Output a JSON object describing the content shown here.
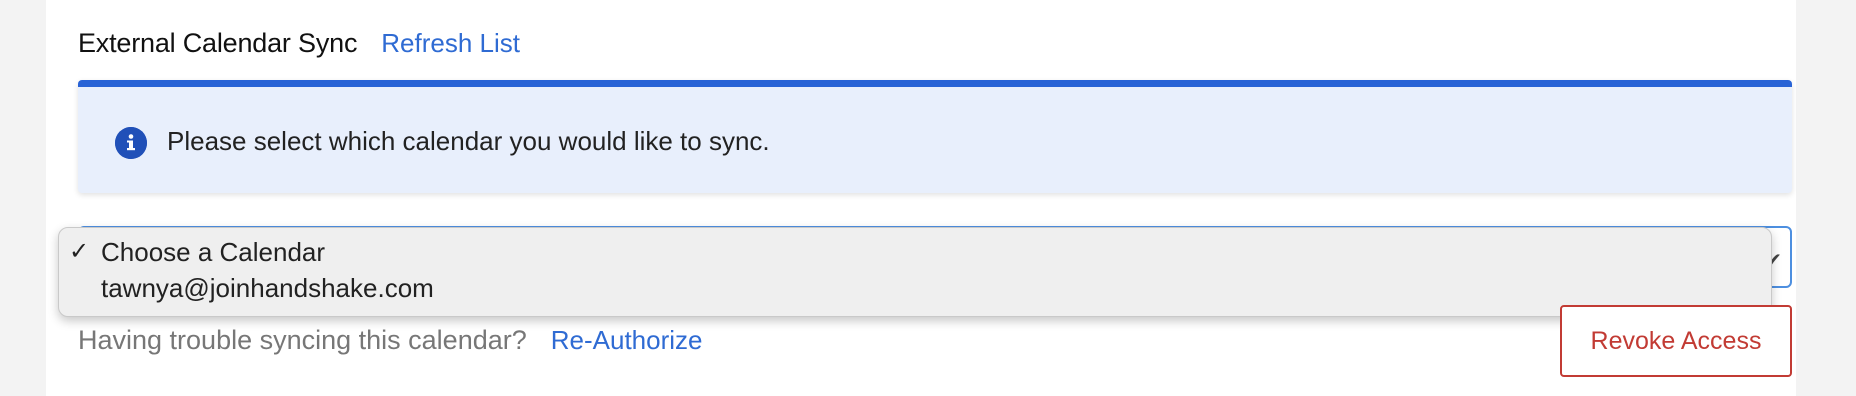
{
  "section": {
    "title": "External Calendar Sync",
    "refresh_label": "Refresh List"
  },
  "alert": {
    "icon": "info-icon",
    "message": "Please select which calendar you would like to sync."
  },
  "calendar_select": {
    "selected_value": "Choose a Calendar",
    "options": [
      {
        "label": "Choose a Calendar",
        "selected": true
      },
      {
        "label": "tawnya@joinhandshake.com",
        "selected": false
      }
    ],
    "check_glyph": "✓"
  },
  "footer": {
    "trouble_text": "Having trouble syncing this calendar?",
    "reauthorize_label": "Re-Authorize",
    "revoke_label": "Revoke Access"
  },
  "colors": {
    "accent_blue": "#2f6bd3",
    "alert_bar": "#2863d6",
    "alert_bg": "#e8effc",
    "danger": "#c23b34"
  }
}
